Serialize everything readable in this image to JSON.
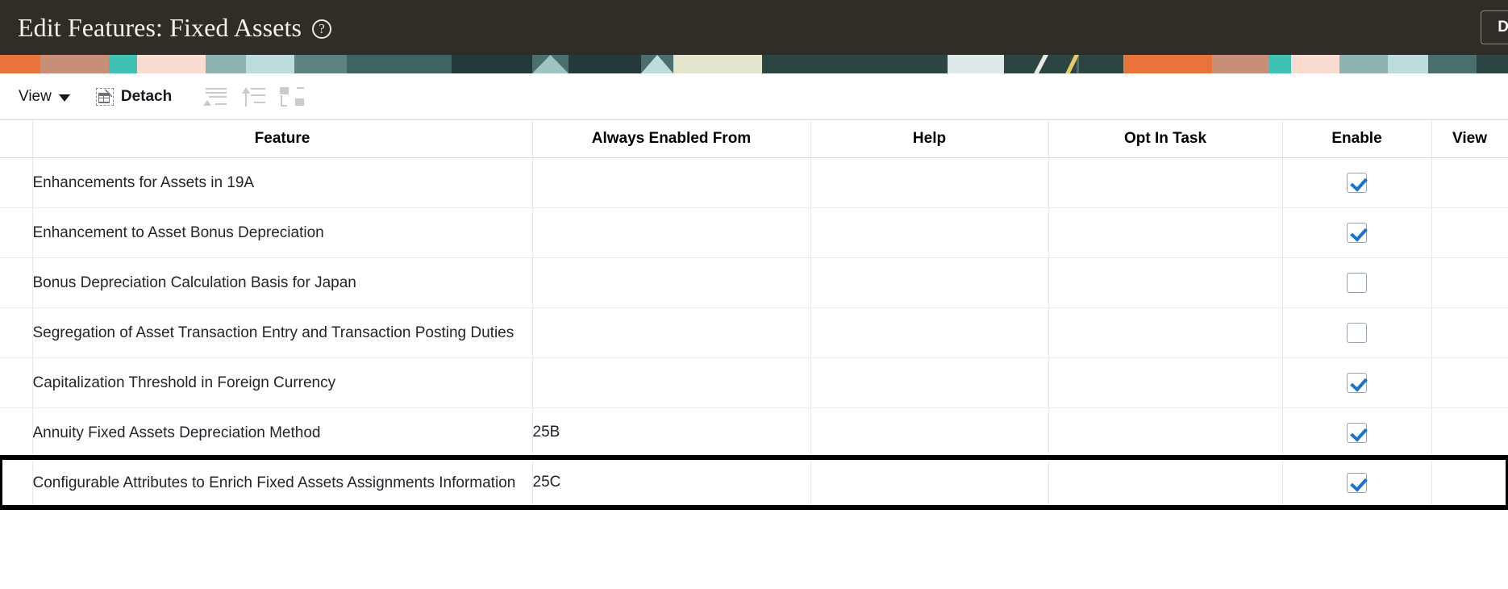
{
  "header": {
    "title": "Edit Features: Fixed Assets",
    "help_icon": "help-circle-icon",
    "done_label": "D",
    "background_color": "#302c28"
  },
  "toolbar": {
    "view_label": "View",
    "view_caret": "chevron-down-icon",
    "detach_label": "Detach",
    "detach_icon": "detach-icon",
    "icons": [
      {
        "name": "collapse-all-icon",
        "enabled": false
      },
      {
        "name": "expand-all-icon",
        "enabled": false
      },
      {
        "name": "tree-hierarchy-icon",
        "enabled": false
      }
    ]
  },
  "table": {
    "columns": [
      {
        "key": "feature",
        "label": "Feature"
      },
      {
        "key": "always_enabled_from",
        "label": "Always Enabled From"
      },
      {
        "key": "help",
        "label": "Help"
      },
      {
        "key": "opt_in_task",
        "label": "Opt In Task"
      },
      {
        "key": "enable",
        "label": "Enable"
      },
      {
        "key": "view",
        "label": "View"
      }
    ],
    "rows": [
      {
        "feature": "Enhancements for Assets in 19A",
        "always_enabled_from": "",
        "enable_checked": true,
        "highlighted": false,
        "wraps": false
      },
      {
        "feature": "Enhancement to Asset Bonus Depreciation",
        "always_enabled_from": "",
        "enable_checked": true,
        "highlighted": false,
        "wraps": false
      },
      {
        "feature": "Bonus Depreciation Calculation Basis for Japan",
        "always_enabled_from": "",
        "enable_checked": false,
        "highlighted": false,
        "wraps": false
      },
      {
        "feature": "Segregation of Asset Transaction Entry and Transaction Posting Duties",
        "always_enabled_from": "",
        "enable_checked": false,
        "highlighted": false,
        "wraps": true
      },
      {
        "feature": "Capitalization Threshold in Foreign Currency",
        "always_enabled_from": "",
        "enable_checked": true,
        "highlighted": false,
        "wraps": false
      },
      {
        "feature": "Annuity Fixed Assets Depreciation Method",
        "always_enabled_from": "25B",
        "enable_checked": true,
        "highlighted": false,
        "wraps": false
      },
      {
        "feature": "Configurable Attributes to Enrich Fixed Assets Assignments Information",
        "always_enabled_from": "25C",
        "enable_checked": true,
        "highlighted": true,
        "wraps": true
      }
    ]
  },
  "banner": {
    "colors": [
      "#e8743b",
      "#c78f78",
      "#3fc2b4",
      "#fbdcd2",
      "#8fb3b3",
      "#bfdcdc",
      "#3f6361",
      "#2d4542",
      "#e2e4cd",
      "#4a6f6d",
      "#e8c96a"
    ]
  }
}
